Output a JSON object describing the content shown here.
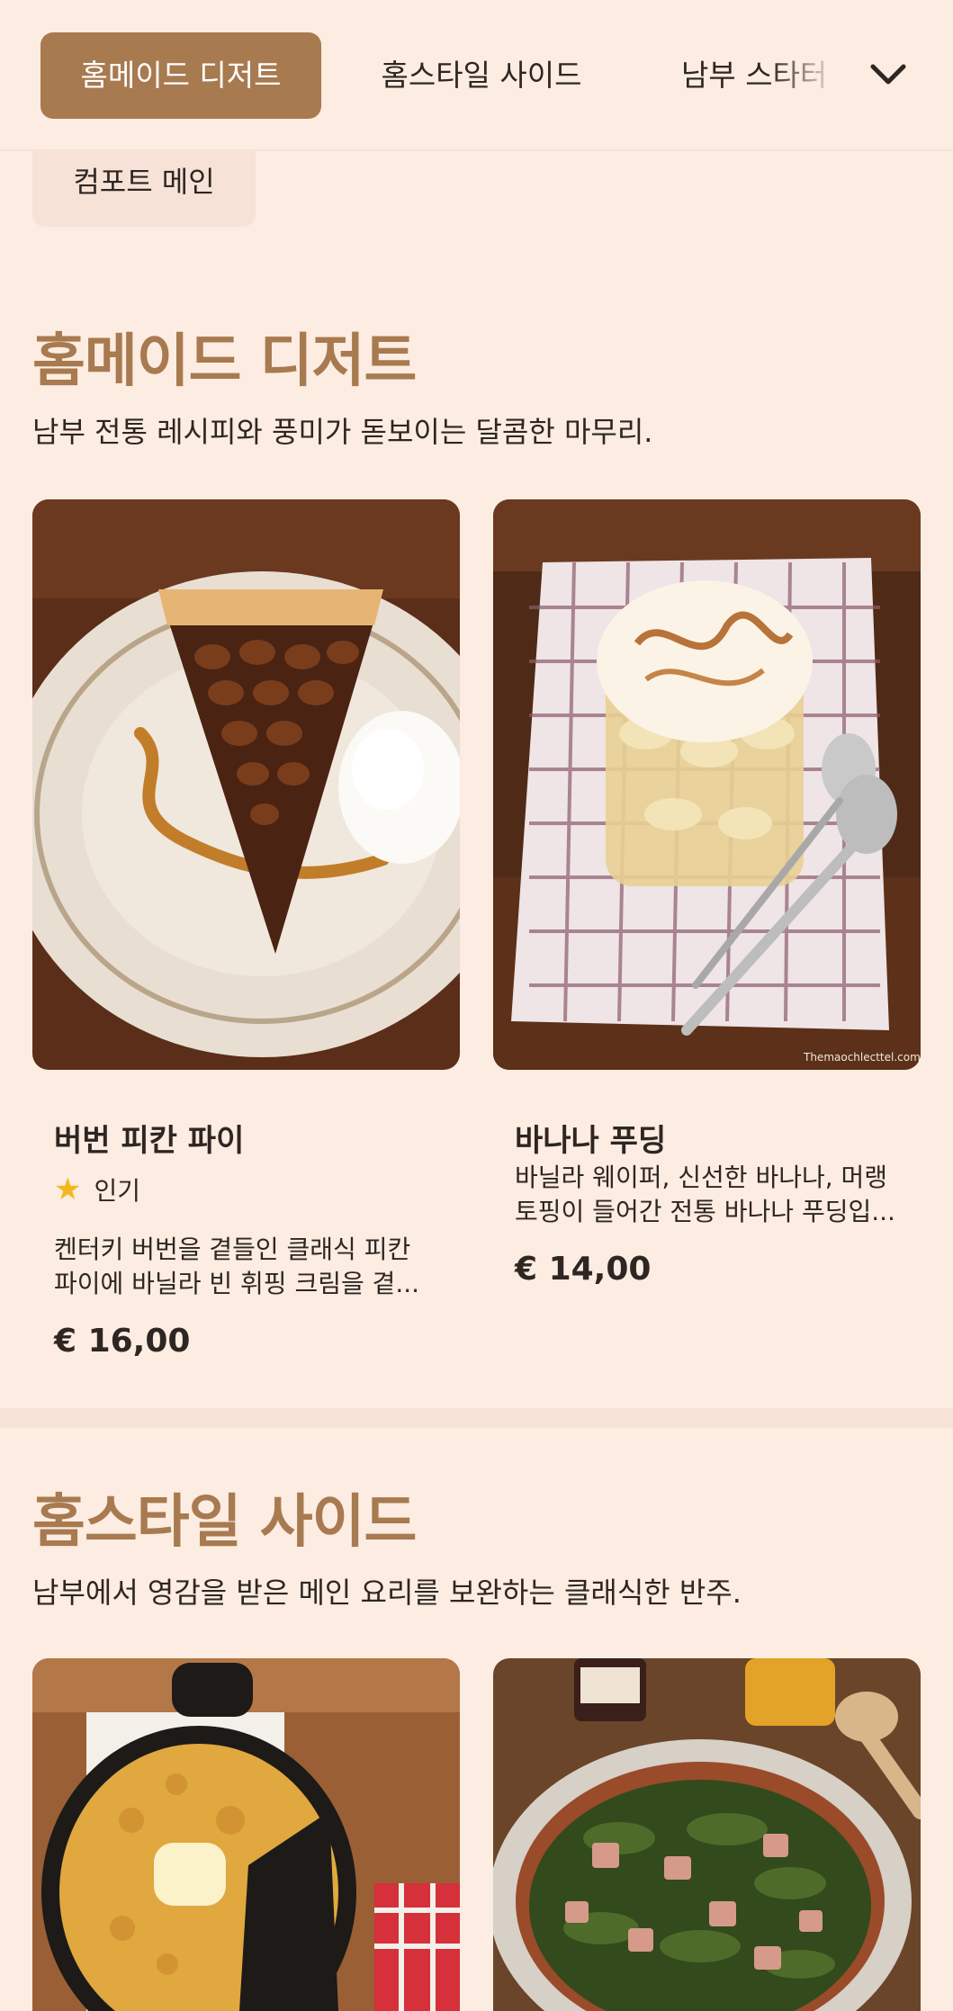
{
  "categories": {
    "active": "홈메이드 디저트",
    "tab2": "홈스타일 사이드",
    "tab3": "남부 스타터",
    "row2": "컴포트 메인"
  },
  "sections": [
    {
      "title": "홈메이드 디저트",
      "subtitle": "남부 전통 레시피와 풍미가 돋보이는 달콤한 마무리.",
      "items": [
        {
          "name": "버번 피칸 파이",
          "badge": "인기",
          "description": "켄터키 버번을 곁들인 클래식 피칸 파이에 바닐라 빈 휘핑 크림을 곁...",
          "price": "€ 16,00",
          "image_icon": "pecan-pie-photo"
        },
        {
          "name": "바나나 푸딩",
          "description": "바닐라 웨이퍼, 신선한 바나나, 머랭 토핑이 들어간 전통 바나나 푸딩입...",
          "price": "€ 14,00",
          "image_icon": "banana-pudding-photo",
          "watermark": "Themaochlecttel.com"
        }
      ]
    },
    {
      "title": "홈스타일 사이드",
      "subtitle": "남부에서 영감을 받은 메인 요리를 보완하는 클래식한 반주.",
      "items": [
        {
          "image_icon": "cornbread-skillet-photo"
        },
        {
          "image_icon": "collard-greens-photo"
        }
      ]
    }
  ],
  "colors": {
    "background": "#fcece1",
    "accent": "#a87a50",
    "text": "#2e2622",
    "star": "#f3b81c"
  }
}
